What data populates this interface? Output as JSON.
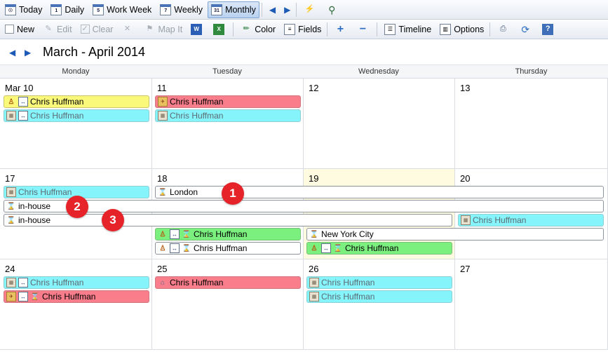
{
  "toolbar1": {
    "today": "Today",
    "daily": "Daily",
    "work_week": "Work Week",
    "weekly": "Weekly",
    "monthly": "Monthly",
    "daily_icon_num": "1",
    "work_week_icon_num": "5",
    "weekly_icon_num": "7",
    "monthly_icon_num": "31"
  },
  "toolbar2": {
    "new": "New",
    "edit": "Edit",
    "clear": "Clear",
    "map_it": "Map It",
    "color": "Color",
    "fields": "Fields",
    "timeline": "Timeline",
    "options": "Options"
  },
  "header": {
    "title": "March - April 2014"
  },
  "days": [
    "Monday",
    "Tuesday",
    "Wednesday",
    "Thursday"
  ],
  "weeks": [
    {
      "dates": [
        "Mar 10",
        "11",
        "12",
        "13"
      ]
    },
    {
      "dates": [
        "17",
        "18",
        "19",
        "20"
      ]
    },
    {
      "dates": [
        "24",
        "25",
        "26",
        "27"
      ]
    }
  ],
  "events": {
    "w1_mon_1": "Chris Huffman",
    "w1_mon_2": "Chris Huffman",
    "w1_tue_1": "Chris Huffman",
    "w1_tue_2": "Chris Huffman",
    "w2_mon_1": "Chris Huffman",
    "w2_london": "London",
    "w2_inhouse_1": "in-house",
    "w2_inhouse_2": "in-house",
    "w2_thu_1": "Chris Huffman",
    "w2_tue_1": "Chris Huffman",
    "w2_tue_2": "Chris Huffman",
    "w2_nyc": "New York City",
    "w2_wed_1": "Chris Huffman",
    "w3_mon_1": "Chris Huffman",
    "w3_mon_2": "Chris Huffman",
    "w3_tue_1": "Chris Huffman",
    "w3_wed_1": "Chris Huffman",
    "w3_wed_2": "Chris Huffman"
  },
  "badges": [
    "1",
    "2",
    "3"
  ],
  "colors": {
    "yellow": "#fbf97a",
    "cyan": "#86f4fb",
    "red": "#f97d8a",
    "green": "#7cf07f",
    "today": "#fffbe0",
    "badge": "#e52329"
  }
}
